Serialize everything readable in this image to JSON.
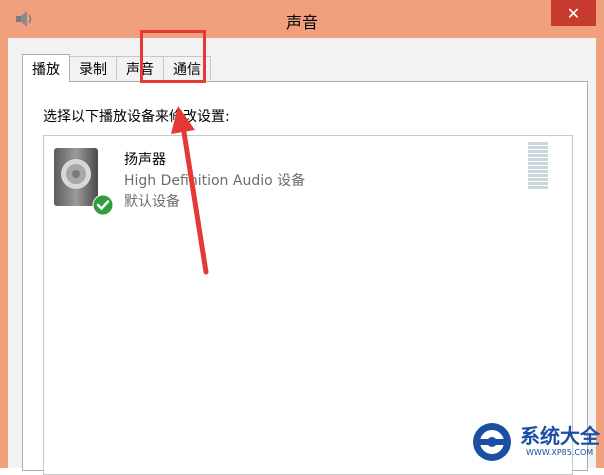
{
  "window": {
    "title": "声音",
    "close_glyph": "✕"
  },
  "tabs": [
    {
      "label": "播放",
      "active": true
    },
    {
      "label": "录制",
      "active": false
    },
    {
      "label": "声音",
      "active": false,
      "highlighted": true
    },
    {
      "label": "通信",
      "active": false
    }
  ],
  "panel": {
    "instruction": "选择以下播放设备来修改设置:"
  },
  "devices": [
    {
      "name": "扬声器",
      "description": "High Definition Audio 设备",
      "status": "默认设备",
      "icon": "speaker-icon",
      "badge": "checkmark-icon"
    }
  ],
  "annotation": {
    "box_color": "#e53935",
    "arrow_color": "#e53935"
  },
  "watermark": {
    "brand": "系统大全",
    "url": "WWW.XP85.COM",
    "color": "#1a4fa3"
  },
  "colors": {
    "titlebar": "#f0a07c",
    "close_button": "#c83a2e"
  }
}
